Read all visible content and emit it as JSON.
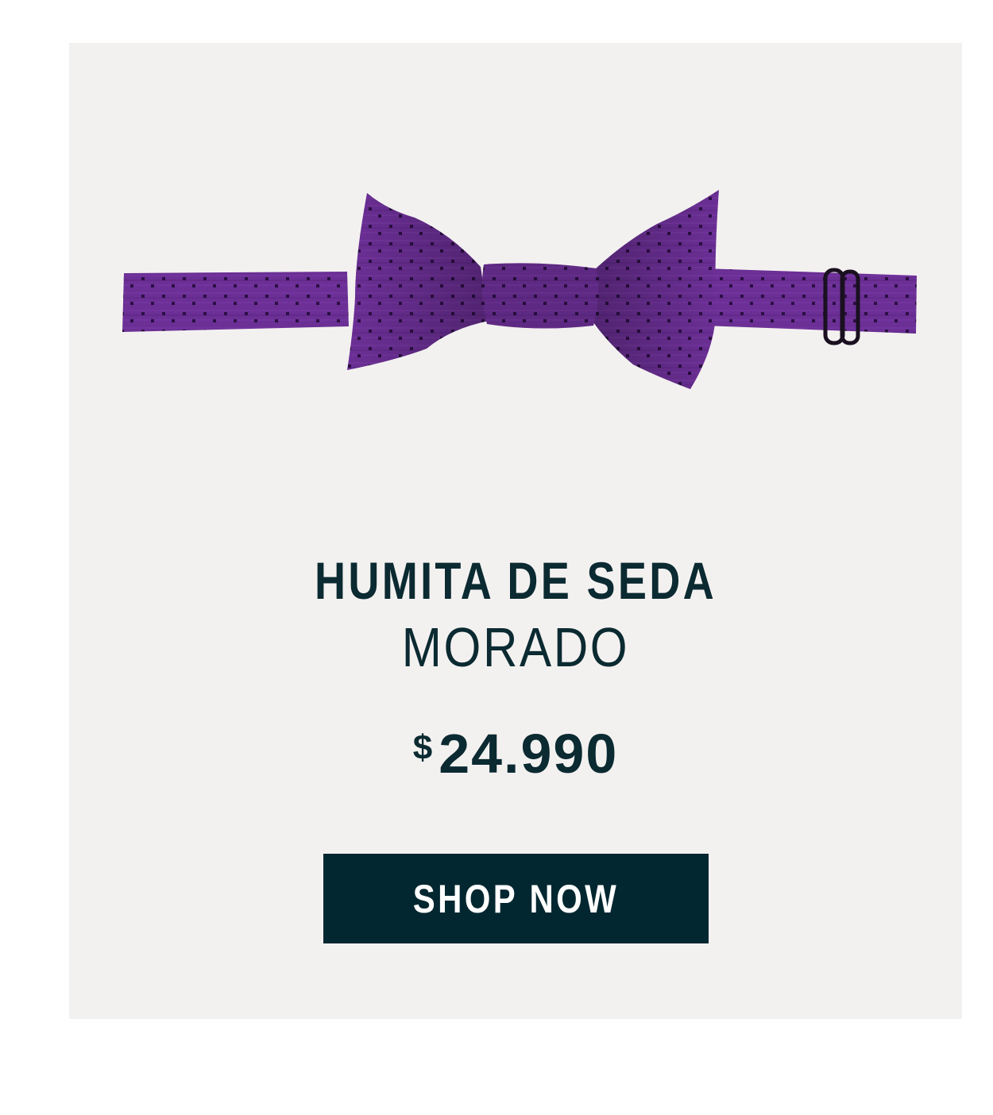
{
  "product": {
    "name": "HUMITA DE SEDA",
    "color_name": "MORADO",
    "price_currency": "$",
    "price_amount": "24.990",
    "image_icon": "purple-bow-tie-image",
    "product_color": "#6a2e93"
  },
  "cta": {
    "label": "SHOP NOW",
    "button_color": "#032730",
    "text_color": "#ffffff"
  },
  "theme": {
    "card_background": "#f3f1f0",
    "text_color": "#0b2a31"
  }
}
